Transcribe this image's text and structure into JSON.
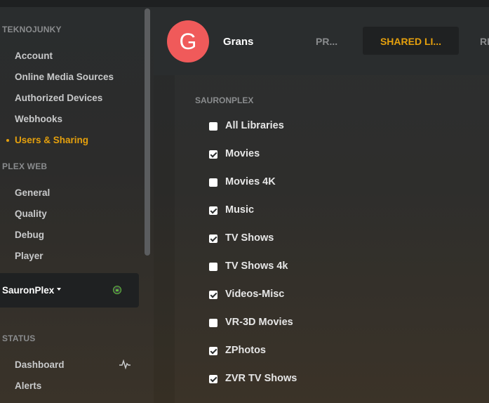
{
  "sidebar": {
    "account_section": "TEKNOJUNKY",
    "account_items": [
      {
        "label": "Account",
        "active": false
      },
      {
        "label": "Online Media Sources",
        "active": false
      },
      {
        "label": "Authorized Devices",
        "active": false
      },
      {
        "label": "Webhooks",
        "active": false
      },
      {
        "label": "Users & Sharing",
        "active": true
      }
    ],
    "web_section": "PLEX WEB",
    "web_items": [
      {
        "label": "General"
      },
      {
        "label": "Quality"
      },
      {
        "label": "Debug"
      },
      {
        "label": "Player"
      }
    ],
    "server": {
      "name": "SauronPlex"
    },
    "status_section": "STATUS",
    "status_items": [
      {
        "label": "Dashboard"
      },
      {
        "label": "Alerts"
      }
    ]
  },
  "header": {
    "avatar_letter": "G",
    "user_name": "Grans",
    "tabs": [
      {
        "label": "PR...",
        "active": false
      },
      {
        "label": "SHARED LI...",
        "active": true
      },
      {
        "label": "RE",
        "active": false
      }
    ]
  },
  "libraries": {
    "server_heading": "SAURONPLEX",
    "items": [
      {
        "label": "All Libraries",
        "checked": false
      },
      {
        "label": "Movies",
        "checked": true
      },
      {
        "label": "Movies 4K",
        "checked": false
      },
      {
        "label": "Music",
        "checked": true
      },
      {
        "label": "TV Shows",
        "checked": true
      },
      {
        "label": "TV Shows 4k",
        "checked": false
      },
      {
        "label": "Videos-Misc",
        "checked": true
      },
      {
        "label": "VR-3D Movies",
        "checked": false
      },
      {
        "label": "ZPhotos",
        "checked": true
      },
      {
        "label": "ZVR TV Shows",
        "checked": true
      }
    ]
  },
  "colors": {
    "accent": "#e5a00d",
    "avatar": "#f05a5a",
    "online": "#5fbf3c"
  }
}
